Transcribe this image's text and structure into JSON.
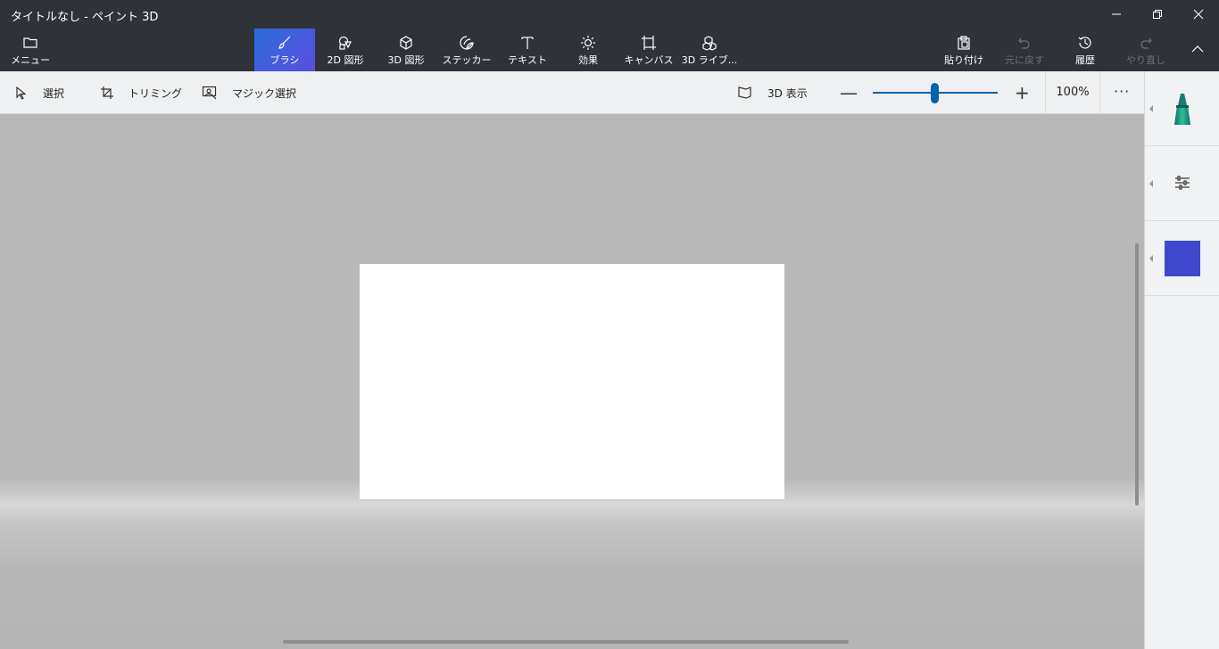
{
  "window": {
    "title": "タイトルなし - ペイント 3D"
  },
  "ribbon": {
    "menu_label": "メニュー",
    "tools": [
      {
        "label": "ブラシ",
        "icon": "brush-icon",
        "active": true
      },
      {
        "label": "2D 図形",
        "icon": "2d-shapes-icon"
      },
      {
        "label": "3D 図形",
        "icon": "3d-shapes-icon"
      },
      {
        "label": "ステッカー",
        "icon": "sticker-icon"
      },
      {
        "label": "テキスト",
        "icon": "text-icon"
      },
      {
        "label": "効果",
        "icon": "effects-icon"
      },
      {
        "label": "キャンバス",
        "icon": "canvas-icon"
      },
      {
        "label": "3D ライブ...",
        "icon": "3d-library-icon"
      }
    ],
    "paste_label": "貼り付け",
    "undo_label": "元に戻す",
    "history_label": "履歴",
    "redo_label": "やり直し"
  },
  "toolbar": {
    "select_label": "選択",
    "crop_label": "トリミング",
    "magic_select_label": "マジック選択",
    "view3d_label": "3D 表示",
    "zoom_out_symbol": "—",
    "zoom_in_symbol": "+",
    "zoom_value": "100%",
    "zoom_level": 0.47,
    "more_symbol": "···"
  },
  "side_panel": {
    "selected_color": "#3f48cc",
    "brush_color": "#1aa88c"
  },
  "colors": {
    "chrome": "#2f3339",
    "accent": "#0063b1",
    "active_tool_gradient": [
      "#2d6bd6",
      "#5a4fe0"
    ],
    "workspace": "#b7b8b7"
  }
}
